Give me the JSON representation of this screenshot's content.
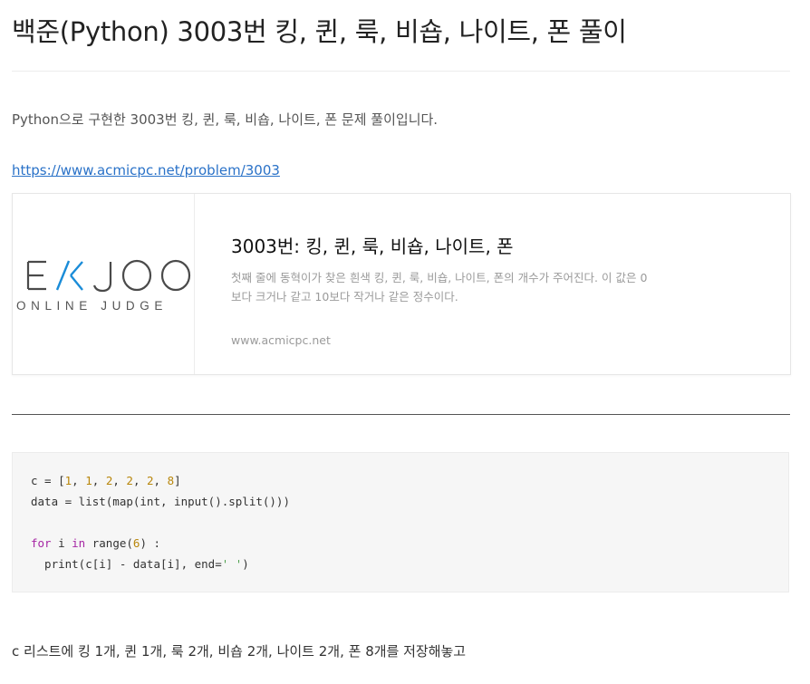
{
  "post": {
    "title": "백준(Python) 3003번 킹, 퀸, 룩, 비숍, 나이트, 폰 풀이",
    "intro": "Python으로 구현한 3003번 킹, 퀸, 룩, 비숍, 나이트, 폰 문제 풀이입니다.",
    "link_text": "https://www.acmicpc.net/problem/3003",
    "summary": "c 리스트에 킹 1개, 퀸 1개, 룩 2개, 비숍 2개, 나이트 2개, 폰 8개를 저장해놓고"
  },
  "link_card": {
    "logo_text": "EKJOO",
    "logo_subtext": "ONLINE JUDGE",
    "logo_accent_color": "#1a8cd8",
    "title": "3003번: 킹, 퀸, 룩, 비숍, 나이트, 폰",
    "description": "첫째 줄에 동혁이가 찾은 흰색 킹, 퀸, 룩, 비숍, 나이트, 폰의 개수가 주어진다. 이 값은 0보다 크거나 같고 10보다 작거나 같은 정수이다.",
    "host": "www.acmicpc.net"
  },
  "code": {
    "line1": {
      "a": "c = [",
      "n1": "1",
      "s1": ", ",
      "n2": "1",
      "s2": ", ",
      "n3": "2",
      "s3": ", ",
      "n4": "2",
      "s4": ", ",
      "n5": "2",
      "s5": ", ",
      "n6": "8",
      "b": "]"
    },
    "line2": "data = list(map(int, input().split()))",
    "line4": {
      "kw_for": "for",
      "mid1": " i ",
      "kw_in": "in",
      "mid2": " range(",
      "num": "6",
      "end": ") :"
    },
    "line5": {
      "a": "  print(c[i] - data[i], end=",
      "str": "' '",
      "b": ")"
    }
  },
  "colors": {
    "link": "#2a72c8",
    "code_background": "#f6f6f6",
    "code_number": "#b8860b",
    "code_keyword": "#a626a4",
    "code_string": "#50a14f"
  }
}
